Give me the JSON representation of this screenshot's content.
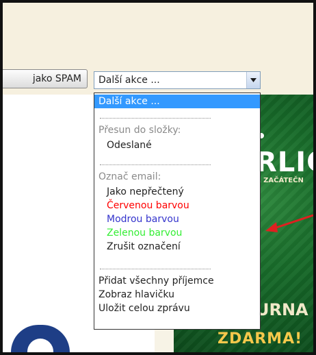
{
  "toolbar": {
    "spam_button_label": "jako SPAM",
    "select_value": "Další akce ..."
  },
  "dropdown": {
    "selected_label": "Další akce ...",
    "group_move": "Přesun do složky:",
    "move_items": [
      "Odeslané"
    ],
    "group_mark": "Označ email:",
    "mark_items": [
      {
        "label": "Jako nepřečtený",
        "color": "#222222"
      },
      {
        "label": "Červenou barvou",
        "color": "#ff0000"
      },
      {
        "label": "Modrou barvou",
        "color": "#3333cc"
      },
      {
        "label": "Zelenou barvou",
        "color": "#33ee33"
      },
      {
        "label": "Zrušit označení",
        "color": "#222222"
      }
    ],
    "action_items": [
      "Přidat všechny příjemce",
      "Zobraz hlavičku",
      "Uložit celou zprávu"
    ]
  },
  "ad": {
    "title": "RLIG",
    "subtitle": "R ZAČÁTEČN",
    "turnaj": "URNA",
    "zdarma": "ZDARMA!"
  },
  "colors": {
    "annotation_arrow": "#e02020",
    "highlight": "#3399ff"
  }
}
